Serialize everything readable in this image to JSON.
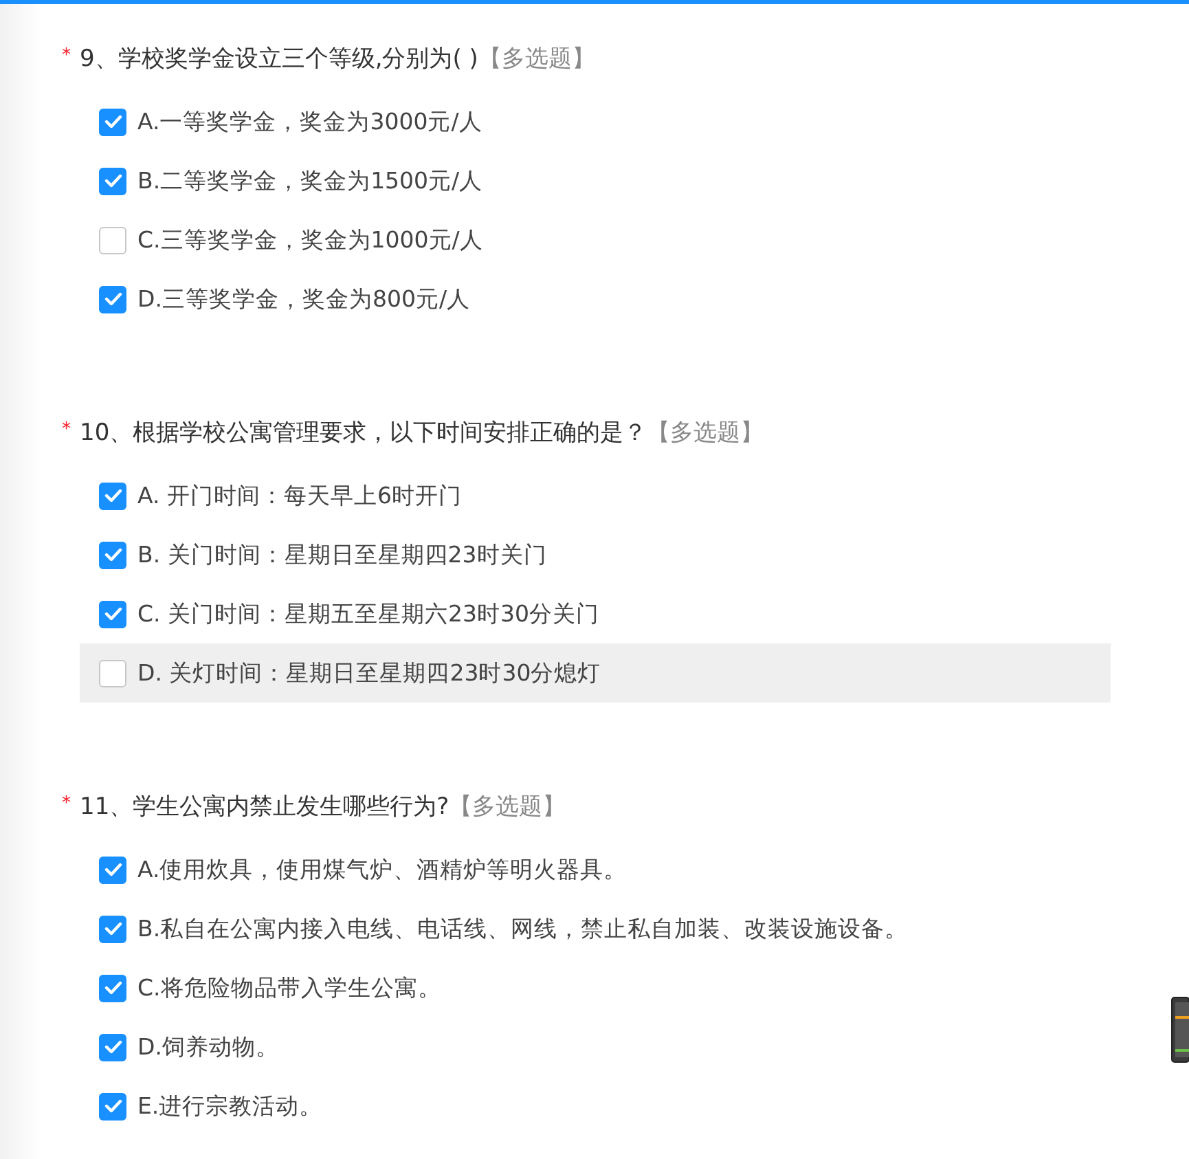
{
  "questions": [
    {
      "required_mark": "*",
      "title": "9、学校奖学金设立三个等级,分别为( )",
      "type_tag": "【多选题】",
      "options": [
        {
          "label": "A.一等奖学金，奖金为3000元/人",
          "checked": true,
          "hovered": false
        },
        {
          "label": "B.二等奖学金，奖金为1500元/人",
          "checked": true,
          "hovered": false
        },
        {
          "label": "C.三等奖学金，奖金为1000元/人",
          "checked": false,
          "hovered": false
        },
        {
          "label": "D.三等奖学金，奖金为800元/人",
          "checked": true,
          "hovered": false
        }
      ]
    },
    {
      "required_mark": "*",
      "title": "10、根据学校公寓管理要求，以下时间安排正确的是？",
      "type_tag": "【多选题】",
      "options": [
        {
          "label": "A. 开门时间：每天早上6时开门",
          "checked": true,
          "hovered": false
        },
        {
          "label": "B. 关门时间：星期日至星期四23时关门",
          "checked": true,
          "hovered": false
        },
        {
          "label": "C. 关门时间：星期五至星期六23时30分关门",
          "checked": true,
          "hovered": false
        },
        {
          "label": "D. 关灯时间：星期日至星期四23时30分熄灯",
          "checked": false,
          "hovered": true
        }
      ]
    },
    {
      "required_mark": "*",
      "title": "11、学生公寓内禁止发生哪些行为?",
      "type_tag": "【多选题】",
      "options": [
        {
          "label": "A.使用炊具，使用煤气炉、酒精炉等明火器具。",
          "checked": true,
          "hovered": false
        },
        {
          "label": "B.私自在公寓内接入电线、电话线、网线，禁止私自加装、改装设施设备。",
          "checked": true,
          "hovered": false
        },
        {
          "label": "C.将危险物品带入学生公寓。",
          "checked": true,
          "hovered": false
        },
        {
          "label": "D.饲养动物。",
          "checked": true,
          "hovered": false
        },
        {
          "label": "E.进行宗教活动。",
          "checked": true,
          "hovered": false
        }
      ]
    }
  ]
}
